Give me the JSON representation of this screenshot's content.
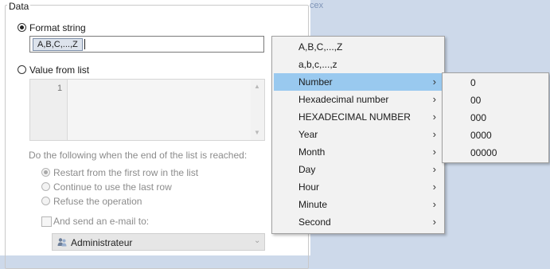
{
  "group": {
    "title": "Data"
  },
  "background_text": "cex",
  "format_option": {
    "label": "Format string",
    "token": "A,B,C,...,Z"
  },
  "list_option": {
    "label": "Value from list",
    "line_number": "1"
  },
  "end_of_list": {
    "prompt": "Do the following when the end of the list is reached:",
    "choices": [
      "Restart from the first row in the list",
      "Continue to use the last row",
      "Refuse the operation"
    ]
  },
  "email": {
    "label": "And send an e-mail to:",
    "recipient": "Administrateur"
  },
  "context_menu": {
    "items": [
      {
        "label": "A,B,C,...,Z",
        "submenu": false
      },
      {
        "label": "a,b,c,...,z",
        "submenu": false
      },
      {
        "label": "Number",
        "submenu": true
      },
      {
        "label": "Hexadecimal number",
        "submenu": true
      },
      {
        "label": "HEXADECIMAL NUMBER",
        "submenu": true
      },
      {
        "label": "Year",
        "submenu": true
      },
      {
        "label": "Month",
        "submenu": true
      },
      {
        "label": "Day",
        "submenu": true
      },
      {
        "label": "Hour",
        "submenu": true
      },
      {
        "label": "Minute",
        "submenu": true
      },
      {
        "label": "Second",
        "submenu": true
      }
    ],
    "highlighted_index": 2,
    "submenu_arrow": "›"
  },
  "number_submenu": {
    "items": [
      "0",
      "00",
      "000",
      "0000",
      "00000"
    ]
  },
  "colors": {
    "highlight": "#99c9ef",
    "menu_bg": "#f2f2f2",
    "disabled_text": "#8c8c8c"
  }
}
